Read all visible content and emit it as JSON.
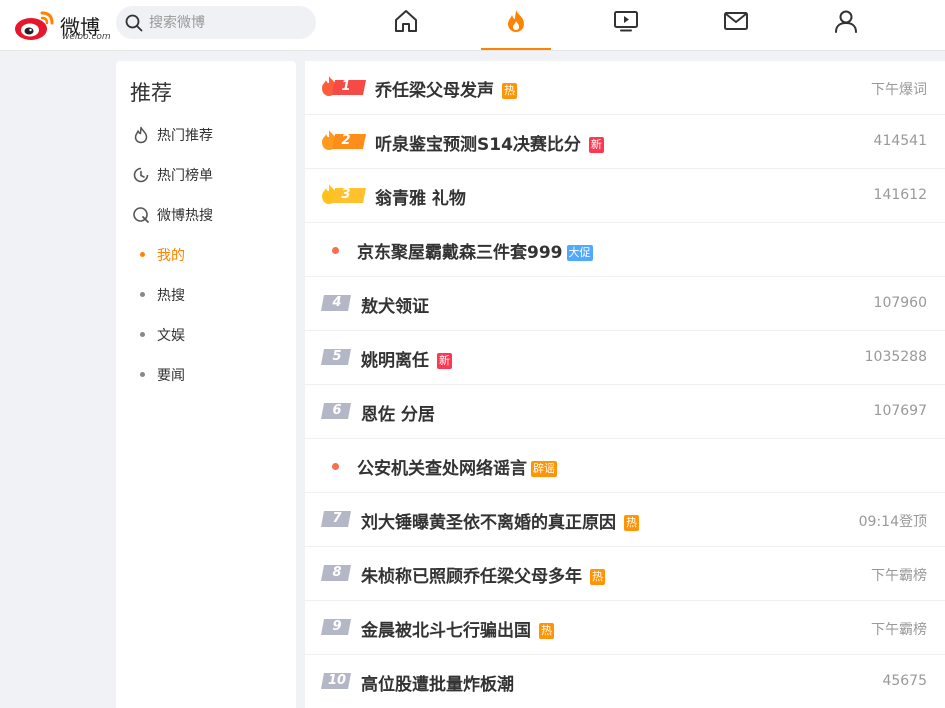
{
  "header": {
    "logo_text": "微博",
    "logo_sub": "weibo.com",
    "search_placeholder": "搜索微博",
    "nav_icons": [
      "home-icon",
      "hot-flame-icon",
      "video-icon",
      "message-icon",
      "profile-icon"
    ],
    "active_nav": "hot-flame-icon",
    "accent_color": "#ff8200"
  },
  "sidebar": {
    "title": "推荐",
    "items": [
      {
        "label": "热门推荐",
        "icon": "flame-outline-icon"
      },
      {
        "label": "热门榜单",
        "icon": "clock-chart-icon"
      },
      {
        "label": "微博热搜",
        "icon": "search-circle-icon"
      },
      {
        "label": "我的",
        "icon": "dot",
        "active": true
      },
      {
        "label": "热搜",
        "icon": "dot"
      },
      {
        "label": "文娱",
        "icon": "dot"
      },
      {
        "label": "要闻",
        "icon": "dot"
      }
    ]
  },
  "hotlist": [
    {
      "rank": "1",
      "title": "乔任梁父母发声",
      "badge": "热",
      "badge_color": "#ff9406",
      "meta": "下午爆词"
    },
    {
      "rank": "2",
      "title": "听泉鉴宝预测S14决赛比分",
      "badge": "新",
      "badge_color": "#ff3852",
      "meta": "414541"
    },
    {
      "rank": "3",
      "title": "翁青雅 礼物",
      "badge": "",
      "meta": "141612"
    },
    {
      "rank": "",
      "title": "京东聚屋霸戴森三件套999",
      "badge": "大促",
      "badge_color": "#4fa9ff",
      "meta": ""
    },
    {
      "rank": "4",
      "title": "敖犬领证",
      "badge": "",
      "meta": "107960"
    },
    {
      "rank": "5",
      "title": "姚明离任",
      "badge": "新",
      "badge_color": "#ff3852",
      "meta": "1035288"
    },
    {
      "rank": "6",
      "title": "恩佐 分居",
      "badge": "",
      "meta": "107697"
    },
    {
      "rank": "",
      "title": "公安机关查处网络谣言",
      "badge": "辟谣",
      "badge_color": "#ff9406",
      "meta": ""
    },
    {
      "rank": "7",
      "title": "刘大锤曝黄圣依不离婚的真正原因",
      "badge": "热",
      "badge_color": "#ff9406",
      "meta": "09:14登顶"
    },
    {
      "rank": "8",
      "title": "朱桢称已照顾乔任梁父母多年",
      "badge": "热",
      "badge_color": "#ff9406",
      "meta": "下午霸榜"
    },
    {
      "rank": "9",
      "title": "金晨被北斗七行骗出国",
      "badge": "热",
      "badge_color": "#ff9406",
      "meta": "下午霸榜"
    },
    {
      "rank": "10",
      "title": "高位股遭批量炸板潮",
      "badge": "",
      "meta": "45675"
    }
  ]
}
